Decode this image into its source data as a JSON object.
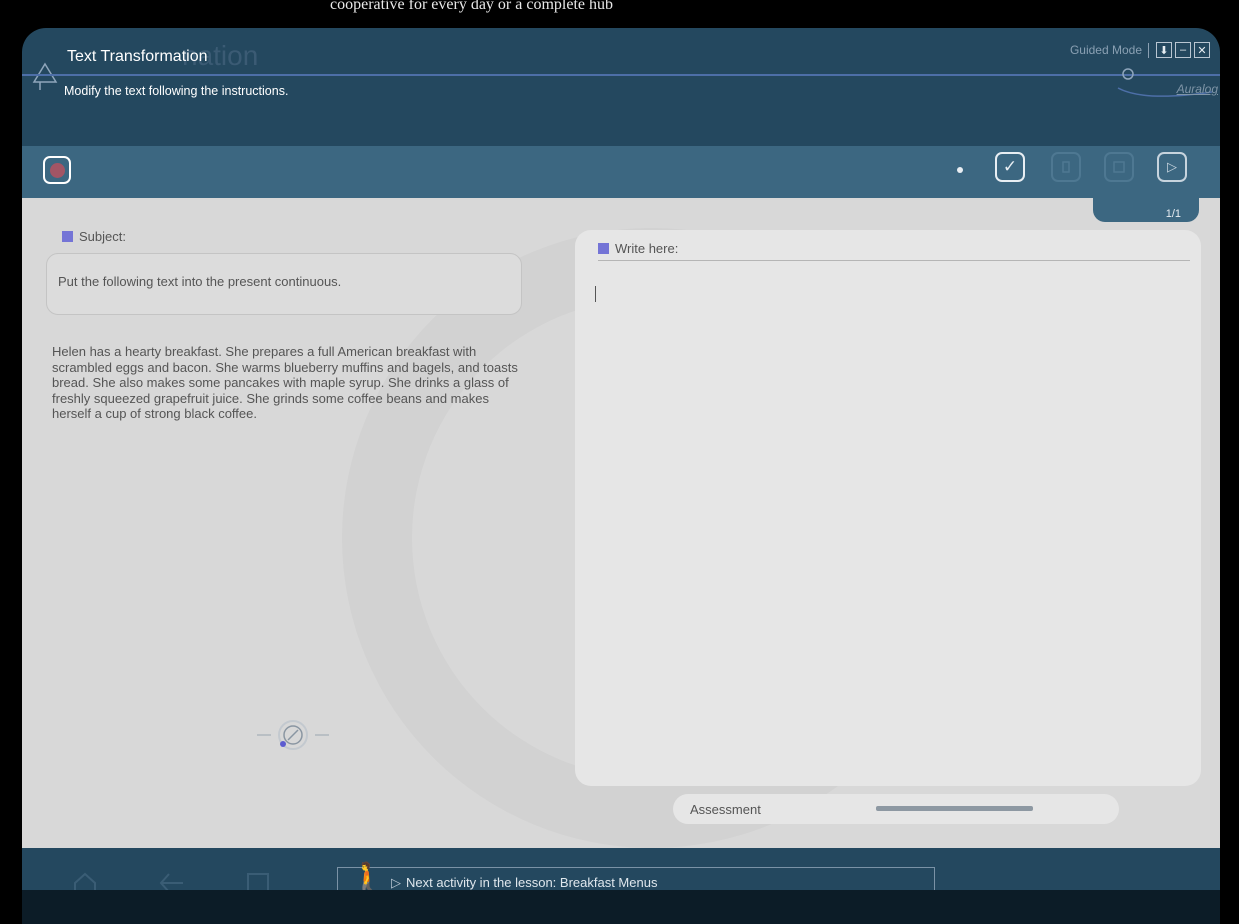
{
  "outer_banner": "cooperative for every day or a complete hub",
  "header": {
    "title": "Text Transformation",
    "ghost_title": "nation",
    "subtitle": "Modify the text following the instructions.",
    "mode": "Guided Mode",
    "brand": "Auralog",
    "window_buttons": [
      {
        "name": "download-icon",
        "glyph": "⬇"
      },
      {
        "name": "minimize-icon",
        "glyph": "–"
      },
      {
        "name": "close-icon",
        "glyph": "✕"
      }
    ]
  },
  "toolbar": {
    "check_glyph": "✓",
    "next_glyph": "▷",
    "page_indicator": "1/1"
  },
  "subject": {
    "label": "Subject:",
    "instruction": "Put the following text into the present continuous.",
    "passage": "Helen has a hearty breakfast. She prepares a full American breakfast with scrambled eggs and bacon. She warms blueberry muffins and bagels, and toasts bread. She also makes some pancakes with maple syrup. She drinks a glass of freshly squeezed grapefruit juice. She grinds some coffee beans and makes herself a cup of strong black coffee."
  },
  "answer": {
    "label": "Write here:",
    "value": ""
  },
  "assessment": {
    "label": "Assessment"
  },
  "footer": {
    "next_activity": "Next activity in the lesson: Breakfast Menus"
  },
  "colors": {
    "frame": "#24485f",
    "toolbar": "#3c6781",
    "content": "#d8d8d8",
    "accent": "#7474d6"
  }
}
